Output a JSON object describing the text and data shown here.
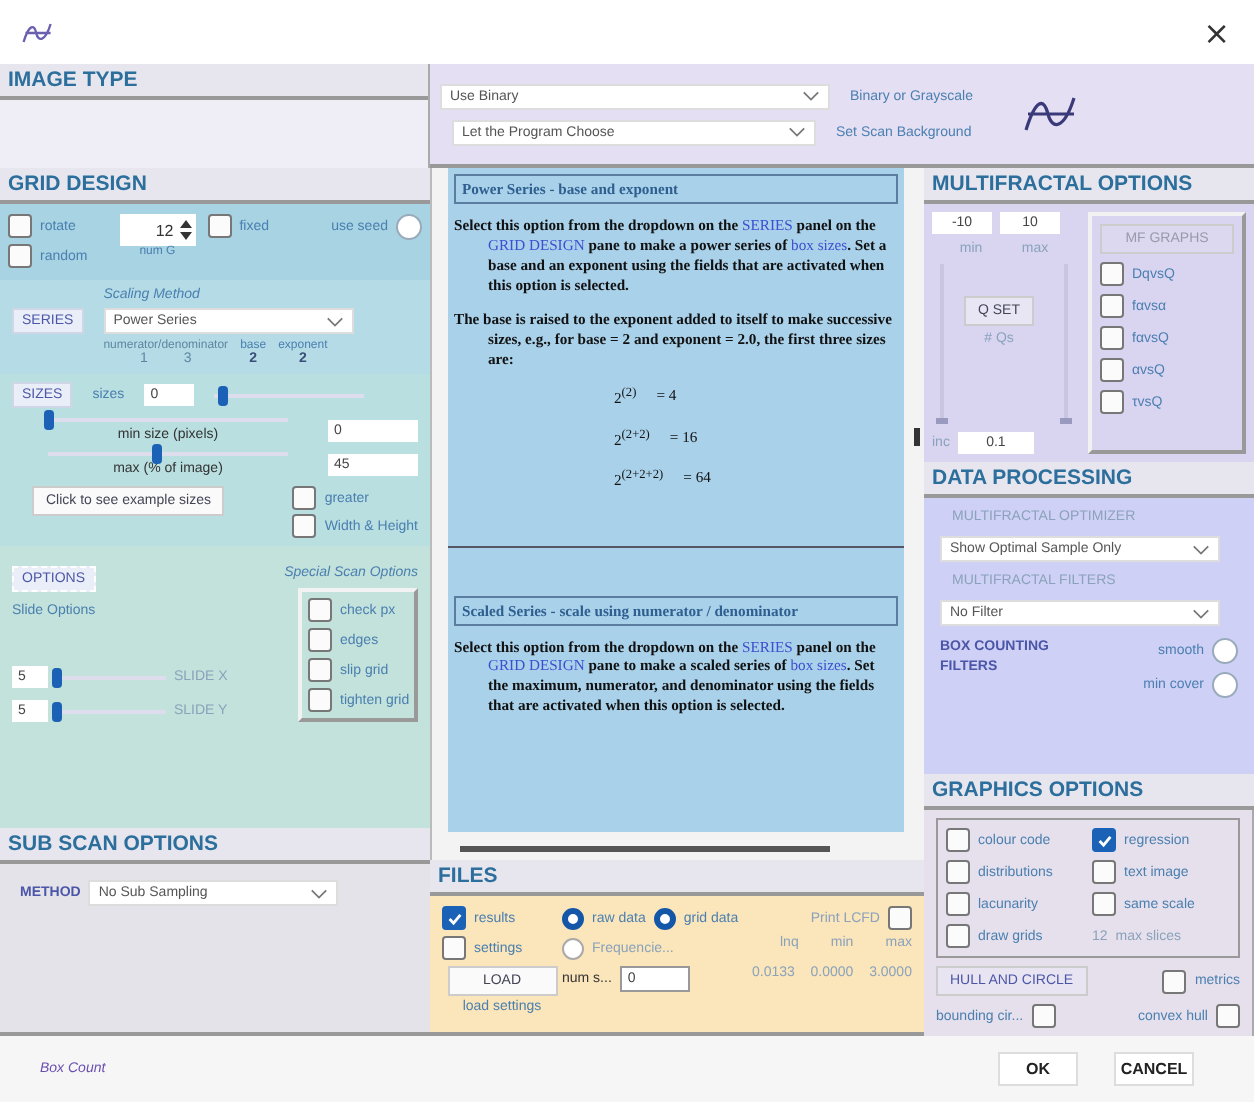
{
  "window": {
    "close": "×"
  },
  "image_type": {
    "title": "IMAGE TYPE",
    "selects": [
      {
        "value": "Use Binary",
        "label": "Binary or Grayscale"
      },
      {
        "value": "Let the Program Choose",
        "label": "Set Scan Background"
      }
    ]
  },
  "grid_design": {
    "title": "GRID DESIGN",
    "top_checks": [
      {
        "label": "rotate",
        "checked": false
      },
      {
        "label": "random",
        "checked": false
      }
    ],
    "num_grids": {
      "value": "12",
      "label": "num G"
    },
    "fixed": {
      "label": "fixed",
      "checked": false
    },
    "use_seed": {
      "label": "use seed",
      "on": false
    },
    "series": {
      "button": "SERIES",
      "method_label": "Scaling Method",
      "method": "Power Series",
      "params": [
        {
          "label": "numerator/denominator",
          "values": [
            "1",
            "3"
          ],
          "disabled": true
        },
        {
          "label": "base",
          "values": [
            "2"
          ],
          "disabled": false
        },
        {
          "label": "exponent",
          "values": [
            "2"
          ],
          "disabled": false
        }
      ]
    },
    "sizes": {
      "button": "SIZES",
      "label": "sizes",
      "value": "0",
      "level": 0.05,
      "sliders": [
        {
          "label": "min size (pixels)",
          "level": 0.0,
          "value": "0"
        },
        {
          "label": "max (% of image)",
          "level": 0.45,
          "value": "45"
        }
      ],
      "example_button": "Click to see example sizes",
      "checks": [
        {
          "label": "greater",
          "checked": false
        },
        {
          "label": "Width & Height",
          "checked": false
        }
      ]
    },
    "options": {
      "button": "OPTIONS",
      "slide_label": "Slide Options",
      "special_label": "Special Scan Options",
      "slides": [
        {
          "value": "5",
          "label": "SLIDE X",
          "level": 0.0
        },
        {
          "value": "5",
          "label": "SLIDE Y",
          "level": 0.0
        }
      ],
      "special": [
        {
          "label": "check px",
          "checked": false
        },
        {
          "label": "edges",
          "checked": false
        },
        {
          "label": "slip grid",
          "checked": false
        },
        {
          "label": "tighten grid",
          "checked": false
        }
      ]
    }
  },
  "sub_scan": {
    "title": "SUB SCAN OPTIONS",
    "method_label": "METHOD",
    "method": "No Sub Sampling"
  },
  "help": {
    "sections": [
      {
        "heading": "Power Series - base and exponent",
        "paragraphs": [
          [
            {
              "text": "Select this option from the dropdown on the "
            },
            {
              "text": "SERIES",
              "link": true
            },
            {
              "text": " panel on the "
            },
            {
              "text": "GRID DESIGN",
              "link": true
            },
            {
              "text": " pane to make a power series of "
            },
            {
              "text": "box sizes",
              "link": true
            },
            {
              "text": ". Set a base and an exponent using the fields that are activated when this option is selected."
            }
          ],
          [
            {
              "text": "The base is raised to the exponent added to itself to make successive sizes, e.g., for base = 2 and exponent = 2.0, the first three sizes are:"
            }
          ]
        ],
        "formulas": [
          {
            "power": "2$^{(2)}$",
            "result": "= 4"
          },
          {
            "power": "2$^{(2+2)}$",
            "result": "= 16"
          },
          {
            "power": "2$^{(2+2+2)}$",
            "result": "= 64"
          }
        ]
      },
      {
        "heading": "Scaled Series - scale using numerator / denominator",
        "paragraphs": [
          [
            {
              "text": "Select this option from the dropdown on the "
            },
            {
              "text": "SERIES",
              "link": true
            },
            {
              "text": " panel on the "
            },
            {
              "text": "GRID DESIGN",
              "link": true
            },
            {
              "text": " pane to make a scaled series of "
            },
            {
              "text": "box sizes",
              "link": true
            },
            {
              "text": ". Set the maximum, numerator, and denominator using the fields that are activated when this option is selected."
            }
          ]
        ]
      }
    ]
  },
  "files": {
    "title": "FILES",
    "checks": [
      {
        "label": "results",
        "checked": true
      },
      {
        "label": "settings",
        "checked": false
      }
    ],
    "radios": [
      {
        "label": "raw data",
        "on": true
      },
      {
        "label": "grid data",
        "on": true
      },
      {
        "label": "Frequencie...",
        "on": false
      }
    ],
    "print": {
      "label": "Print LCFD",
      "checked": false
    },
    "load_button": "LOAD",
    "load_label": "load settings",
    "num": {
      "label": "num s...",
      "value": "0"
    },
    "stats": [
      {
        "label": "lnq",
        "value": "0.0133"
      },
      {
        "label": "min",
        "value": "0.0000"
      },
      {
        "label": "max",
        "value": "3.0000"
      }
    ]
  },
  "multifractal": {
    "title": "MULTIFRACTAL OPTIONS",
    "q_range": [
      {
        "value": "-10",
        "label": "min",
        "level": 0.0
      },
      {
        "value": "10",
        "label": "max",
        "level": 0.0
      }
    ],
    "qset_button": "Q SET",
    "qs_label": "# Qs",
    "inc": {
      "label": "inc",
      "value": "0.1"
    },
    "graphs_button": "MF GRAPHS",
    "graphs": [
      {
        "label": "DqvsQ",
        "checked": false
      },
      {
        "label": "fαvsα",
        "checked": false
      },
      {
        "label": "fαvsQ",
        "checked": false
      },
      {
        "label": "αvsQ",
        "checked": false
      },
      {
        "label": "τvsQ",
        "checked": false
      }
    ]
  },
  "data_processing": {
    "title": "DATA PROCESSING",
    "optimizer_label": "MULTIFRACTAL OPTIMIZER",
    "optimizer": "Show Optimal Sample Only",
    "filters_label": "MULTIFRACTAL FILTERS",
    "filter": "No Filter",
    "box_label": "BOX COUNTING FILTERS",
    "toggles": [
      {
        "label": "smooth",
        "on": false
      },
      {
        "label": "min cover",
        "on": false
      }
    ]
  },
  "graphics": {
    "title": "GRAPHICS OPTIONS",
    "checks": [
      {
        "label": "colour code",
        "checked": false
      },
      {
        "label": "regression",
        "checked": true
      },
      {
        "label": "distributions",
        "checked": false
      },
      {
        "label": "text image",
        "checked": false
      },
      {
        "label": "lacunarity",
        "checked": false
      },
      {
        "label": "same scale",
        "checked": false
      },
      {
        "label": "draw grids",
        "checked": false
      }
    ],
    "slices": {
      "value": "12",
      "label": "max slices"
    },
    "hull_button": "HULL AND CIRCLE",
    "metrics": {
      "label": "metrics",
      "checked": false
    },
    "hull_checks": [
      {
        "label": "bounding cir...",
        "checked": false
      },
      {
        "label": "convex hull",
        "checked": false
      }
    ]
  },
  "footer": {
    "status": "Box Count",
    "buttons": [
      "OK",
      "CANCEL"
    ]
  }
}
